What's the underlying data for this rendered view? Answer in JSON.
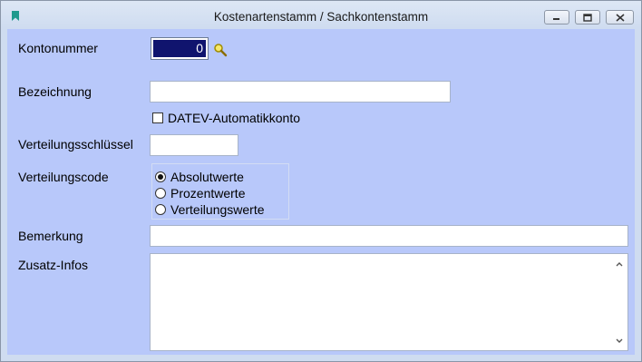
{
  "window": {
    "title": "Kostenartenstamm / Sachkontenstamm"
  },
  "icons": {
    "app": "bookmark-icon",
    "search": "magnifier-icon",
    "minimize": "minimize-icon",
    "maximize": "maximize-icon",
    "close": "close-icon"
  },
  "form": {
    "kontonummer": {
      "label": "Kontonummer",
      "value": "0"
    },
    "bezeichnung": {
      "label": "Bezeichnung",
      "value": ""
    },
    "datev": {
      "label": "DATEV-Automatikkonto",
      "checked": false
    },
    "verteilungsschluessel": {
      "label": "Verteilungsschlüssel",
      "value": ""
    },
    "verteilungscode": {
      "label": "Verteilungscode",
      "options": [
        "Absolutwerte",
        "Prozentwerte",
        "Verteilungswerte"
      ],
      "selected": "Absolutwerte"
    },
    "bemerkung": {
      "label": "Bemerkung",
      "value": ""
    },
    "zusatz_infos": {
      "label": "Zusatz-Infos",
      "value": ""
    }
  },
  "colors": {
    "client_bg": "#b8c8fa",
    "selection": "#10146e"
  }
}
